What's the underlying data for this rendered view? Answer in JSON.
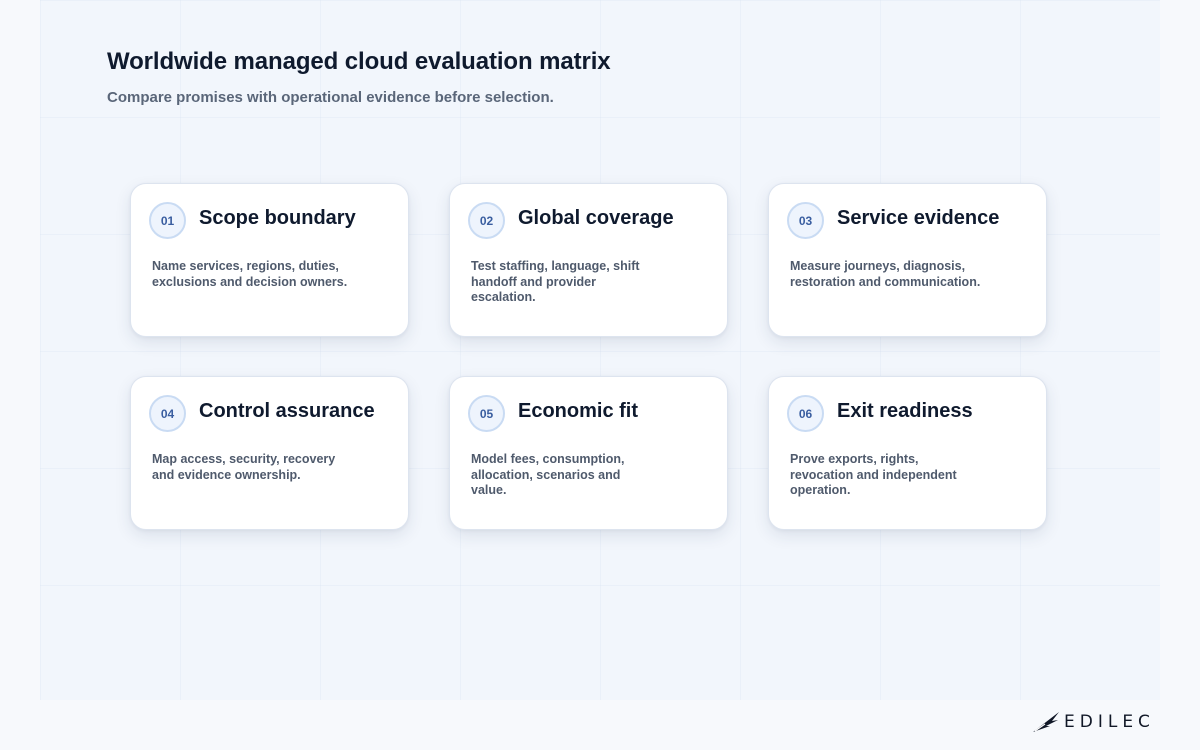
{
  "header": {
    "title": "Worldwide managed cloud evaluation matrix",
    "subtitle": "Compare promises with operational evidence before selection."
  },
  "cards": [
    {
      "number": "01",
      "title": "Scope boundary",
      "description": "Name services, regions, duties, exclusions and decision owners."
    },
    {
      "number": "02",
      "title": "Global coverage",
      "description": "Test staffing, language, shift handoff and provider escalation."
    },
    {
      "number": "03",
      "title": "Service evidence",
      "description": "Measure journeys, diagnosis, restoration and communication."
    },
    {
      "number": "04",
      "title": "Control assurance",
      "description": "Map access, security, recovery and evidence ownership."
    },
    {
      "number": "05",
      "title": "Economic fit",
      "description": "Model fees, consumption, allocation, scenarios and value."
    },
    {
      "number": "06",
      "title": "Exit readiness",
      "description": "Prove exports, rights, revocation and independent operation."
    }
  ],
  "brand": {
    "name": "EDILEC",
    "logo_icon": "wing-logo-icon"
  },
  "colors": {
    "accent": "#3a5ea0",
    "badge_bg": "#eef4fd",
    "title": "#0f1a2e",
    "body": "#4f5a6c"
  }
}
